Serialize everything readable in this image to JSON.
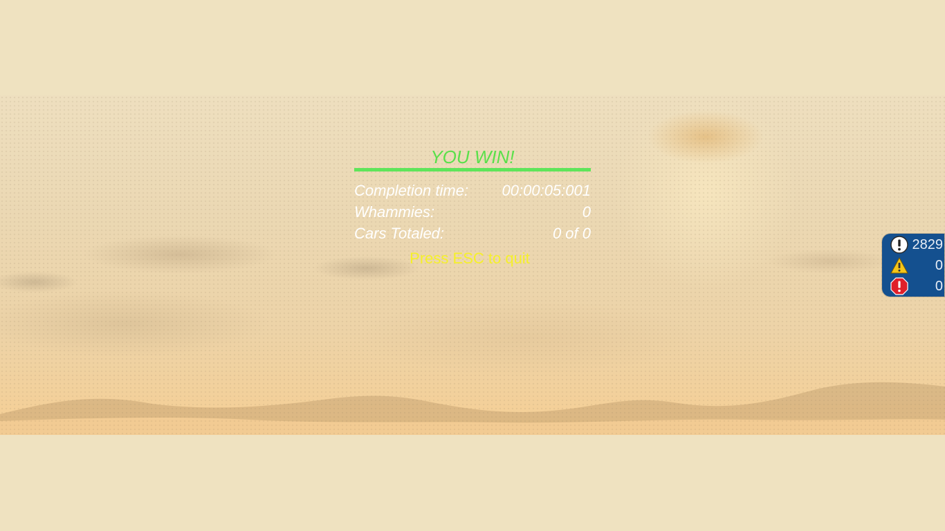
{
  "results": {
    "title": "YOU WIN!",
    "stats": [
      {
        "label": "Completion time:",
        "value": "00:00:05:001"
      },
      {
        "label": "Whammies:",
        "value": "0"
      },
      {
        "label": "Cars Totaled:",
        "value": "0 of 0"
      }
    ],
    "quit_hint": "Press ESC to quit"
  },
  "counters": {
    "info": {
      "icon": "info-icon",
      "value": "2829"
    },
    "warning": {
      "icon": "warning-icon",
      "value": "0"
    },
    "error": {
      "icon": "error-icon",
      "value": "0"
    }
  },
  "colors": {
    "title": "#5ae04a",
    "underline": "#5fe55a",
    "stat_text": "#ffffff",
    "quit_hint": "#f5f02a",
    "badge_bg": "#14508f",
    "page_bg": "#efe2c0"
  }
}
